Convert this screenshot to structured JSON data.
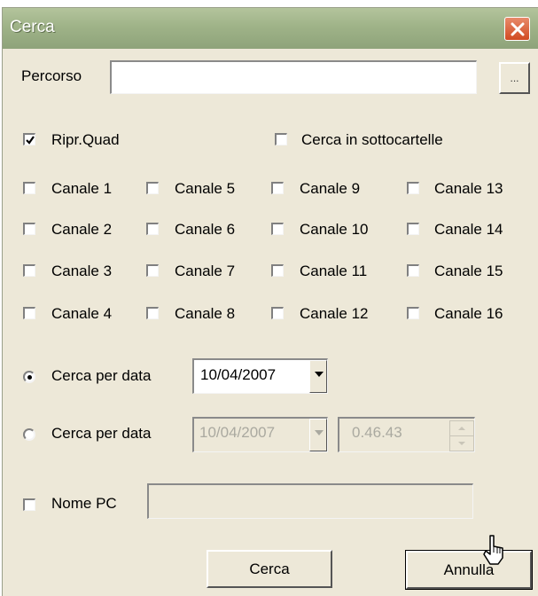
{
  "window": {
    "title": "Cerca"
  },
  "path": {
    "label": "Percorso",
    "value": "",
    "browse_label": "..."
  },
  "options": {
    "ripr_quad": {
      "label": "Ripr.Quad",
      "checked": true
    },
    "subfolders": {
      "label": "Cerca in sottocartelle",
      "checked": false
    }
  },
  "channels": [
    {
      "label": "Canale 1",
      "checked": false
    },
    {
      "label": "Canale 2",
      "checked": false
    },
    {
      "label": "Canale 3",
      "checked": false
    },
    {
      "label": "Canale 4",
      "checked": false
    },
    {
      "label": "Canale 5",
      "checked": false
    },
    {
      "label": "Canale 6",
      "checked": false
    },
    {
      "label": "Canale 7",
      "checked": false
    },
    {
      "label": "Canale 8",
      "checked": false
    },
    {
      "label": "Canale 9",
      "checked": false
    },
    {
      "label": "Canale 10",
      "checked": false
    },
    {
      "label": "Canale 11",
      "checked": false
    },
    {
      "label": "Canale 12",
      "checked": false
    },
    {
      "label": "Canale 13",
      "checked": false
    },
    {
      "label": "Canale 14",
      "checked": false
    },
    {
      "label": "Canale 15",
      "checked": false
    },
    {
      "label": "Canale 16",
      "checked": false
    }
  ],
  "date_search_1": {
    "label": "Cerca per data",
    "selected": true,
    "date": "10/04/2007"
  },
  "date_search_2": {
    "label": "Cerca per data",
    "selected": false,
    "date": "10/04/2007",
    "time": "0.46.43"
  },
  "pc_name": {
    "label": "Nome PC",
    "checked": false,
    "value": ""
  },
  "buttons": {
    "search": "Cerca",
    "cancel": "Annulla"
  },
  "icons": {
    "close": "close-icon",
    "checkmark": "checkmark-icon",
    "dropdown": "chevron-down-icon",
    "cursor": "mouse-pointer-icon"
  },
  "colors": {
    "titlebar": "#9fb388",
    "dialog_bg": "#ede8d8",
    "close_button": "#d14a22",
    "disabled_text": "#aaa9a0"
  }
}
